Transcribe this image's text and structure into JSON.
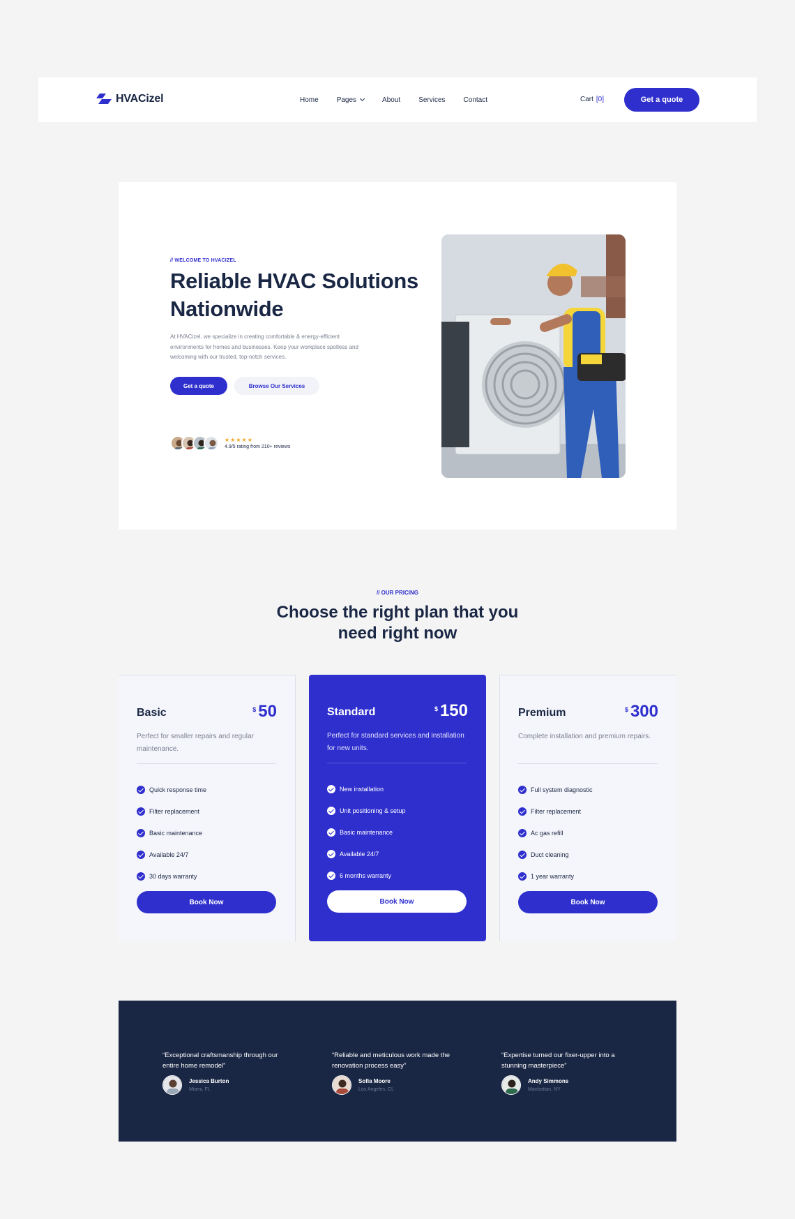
{
  "nav": {
    "logo_text": "HVACizel",
    "menu": [
      "Home",
      "Pages",
      "About",
      "Services",
      "Contact"
    ],
    "cart_label": "Cart",
    "cart_count": "[0]",
    "quote_button": "Get a quote"
  },
  "hero": {
    "eyebrow": "// WELCOME TO HVACIZEL",
    "title": "Reliable HVAC Solutions Nationwide",
    "description": "At HVACizel, we specialize in creating comfortable & energy-efficient environments for homes and businesses. Keep your workplace spotless and welcoming with our trusted, top-notch services.",
    "primary_button": "Get a quote",
    "secondary_button": "Browse Our Services",
    "stars": "★★★★★",
    "rating_text": "4.9/5 rating from 210+ reviews"
  },
  "pricing": {
    "eyebrow": "// OUR PRICING",
    "title": "Choose the right plan that you need right now",
    "plans": [
      {
        "name": "Basic",
        "currency": "$",
        "price": "50",
        "description": "Perfect for smaller repairs and regular maintenance.",
        "features": [
          "Quick response time",
          "Filter replacement",
          "Basic maintenance",
          "Available 24/7",
          "30 days warranty"
        ],
        "button": "Book Now"
      },
      {
        "name": "Standard",
        "currency": "$",
        "price": "150",
        "description": "Perfect for standard services and installation for new units.",
        "features": [
          "New installation",
          "Unit positioning & setup",
          "Basic maintenance",
          "Available 24/7",
          "6 months warranty"
        ],
        "button": "Book Now"
      },
      {
        "name": "Premium",
        "currency": "$",
        "price": "300",
        "description": "Complete installation and premium repairs.",
        "features": [
          "Full system diagnostic",
          "Filter replacement",
          "Ac gas refill",
          "Duct cleaning",
          "1 year warranty"
        ],
        "button": "Book Now"
      }
    ]
  },
  "testimonials": [
    {
      "quote": "“Exceptional craftsmanship through our entire home remodel”",
      "name": "Jessica Burton",
      "location": "Miami, FL"
    },
    {
      "quote": "“Reliable and meticulous work made the renovation process easy”",
      "name": "Sofia Moore",
      "location": "Los Angeles, CL"
    },
    {
      "quote": "“Expertise turned our fixer-upper into a stunning masterpiece”",
      "name": "Andy Simmons",
      "location": "Manhattan, NY"
    }
  ],
  "colors": {
    "accent": "#2f2fce",
    "navy": "#1a2744",
    "star": "#f5a623"
  }
}
